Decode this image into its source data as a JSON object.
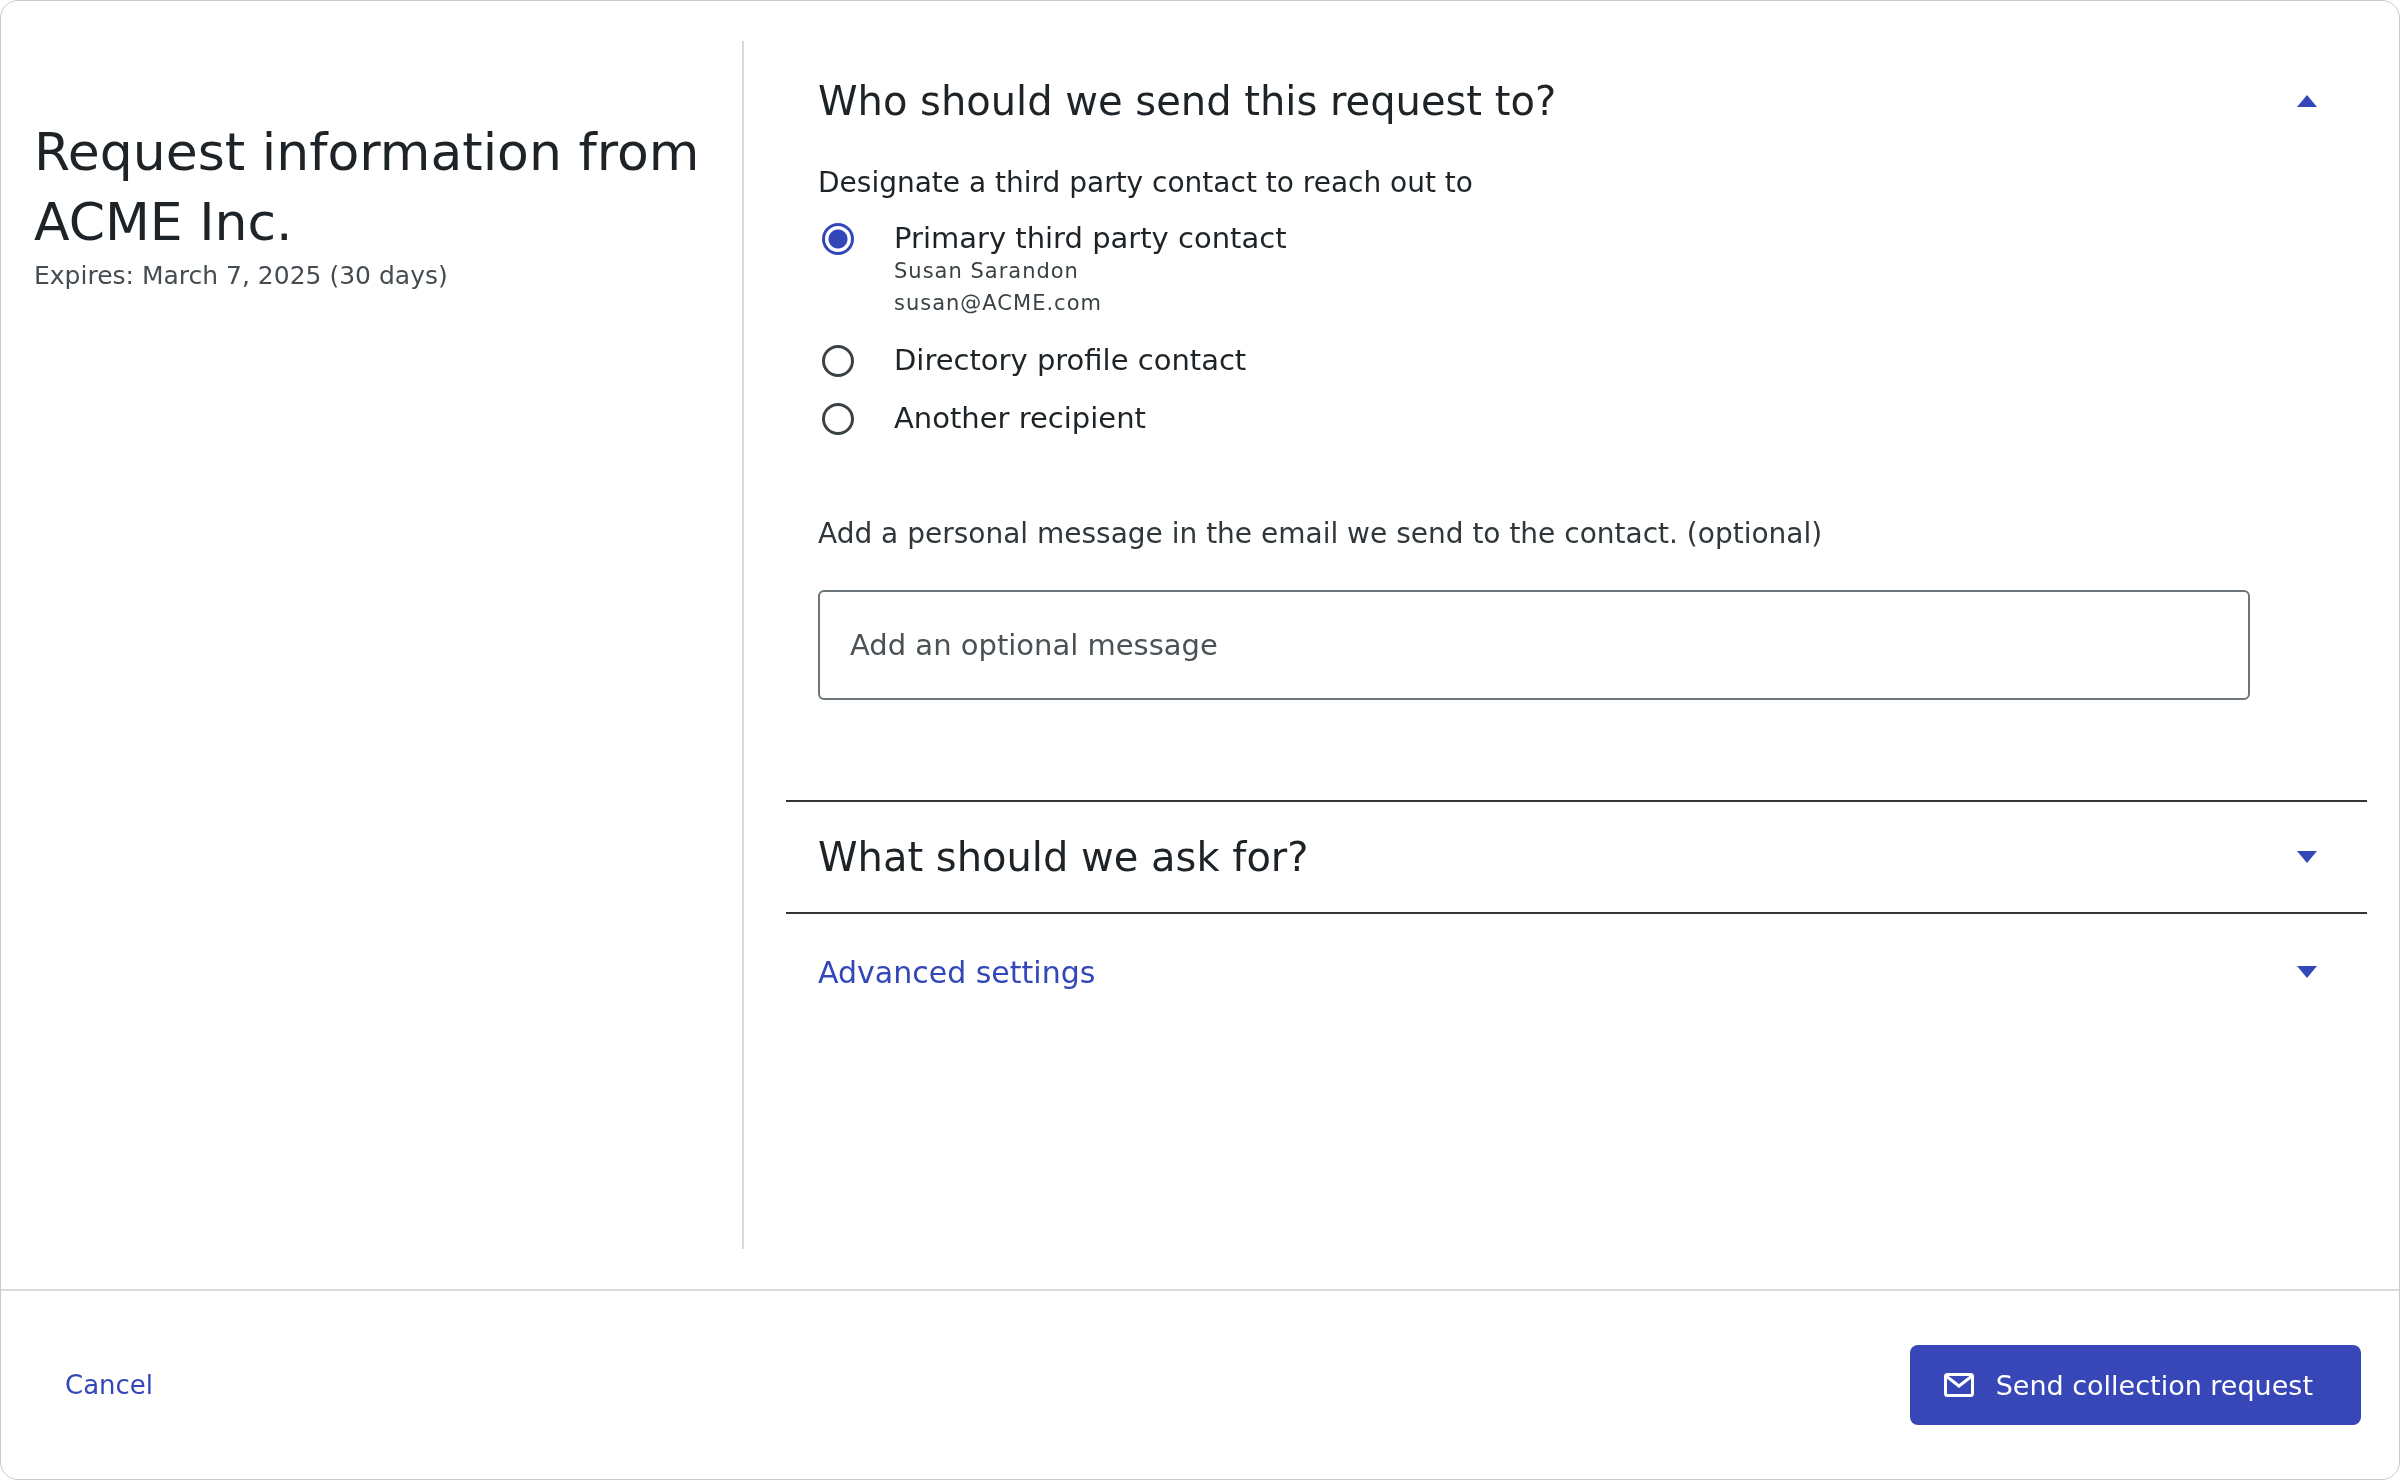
{
  "summary": {
    "title": "Request information from ACME Inc.",
    "expires": "Expires: March 7, 2025 (30 days)"
  },
  "sections": [
    {
      "kind": "recipient",
      "title": "Who should we send this request to?",
      "expanded": true,
      "prompt": "Designate a third party contact to reach out to",
      "options": [
        {
          "label": "Primary third party contact",
          "selected": true,
          "details": [
            "Susan Sarandon",
            "susan@ACME.com"
          ]
        },
        {
          "label": "Directory profile contact",
          "selected": false
        },
        {
          "label": "Another recipient",
          "selected": false
        }
      ],
      "message_label": "Add a personal message in the email we send to the contact. (optional)",
      "message": {
        "placeholder": "Add an optional message"
      }
    },
    {
      "kind": "plain",
      "title": "What should we ask for?",
      "expanded": false
    },
    {
      "kind": "link",
      "title": "Advanced settings",
      "expanded": false
    }
  ],
  "footer": {
    "cancel": "Cancel",
    "submit": "Send collection request"
  }
}
